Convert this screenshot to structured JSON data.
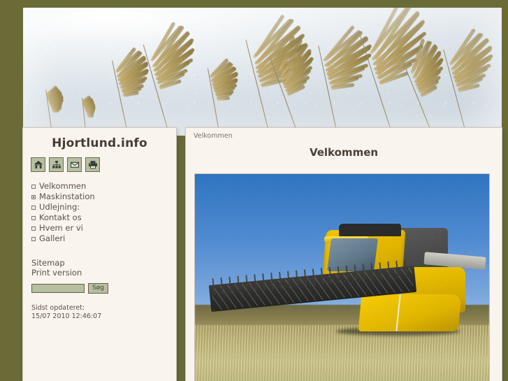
{
  "site": {
    "title": "Hjortlund.info",
    "frame_color": "#6b6b38",
    "panel_bg": "#faf4ef",
    "accent_green": "#b5c0a2",
    "text_color": "#5b5047"
  },
  "toolbar_icons": [
    {
      "name": "home-icon",
      "label": "Home"
    },
    {
      "name": "sitemap-icon",
      "label": "Sitemap"
    },
    {
      "name": "email-icon",
      "label": "Contact"
    },
    {
      "name": "print-icon",
      "label": "Print"
    }
  ],
  "nav": {
    "items": [
      {
        "label": "Velkommen",
        "expandable": false
      },
      {
        "label": "Maskinstation",
        "expandable": true
      },
      {
        "label": "Udlejning:",
        "expandable": false
      },
      {
        "label": "Kontakt os",
        "expandable": false
      },
      {
        "label": "Hvem er vi",
        "expandable": false
      },
      {
        "label": "Galleri",
        "expandable": false
      }
    ]
  },
  "extra_links": [
    {
      "label": "Sitemap"
    },
    {
      "label": "Print version"
    }
  ],
  "search": {
    "value": "",
    "placeholder": "",
    "button_label": "Søg"
  },
  "updated": {
    "label": "Sidst opdateret:",
    "timestamp": "15/07 2010 12:46:07"
  },
  "content": {
    "breadcrumb": "Velkommen",
    "heading": "Velkommen",
    "photo_alt": "Yellow combine harvester in field"
  }
}
